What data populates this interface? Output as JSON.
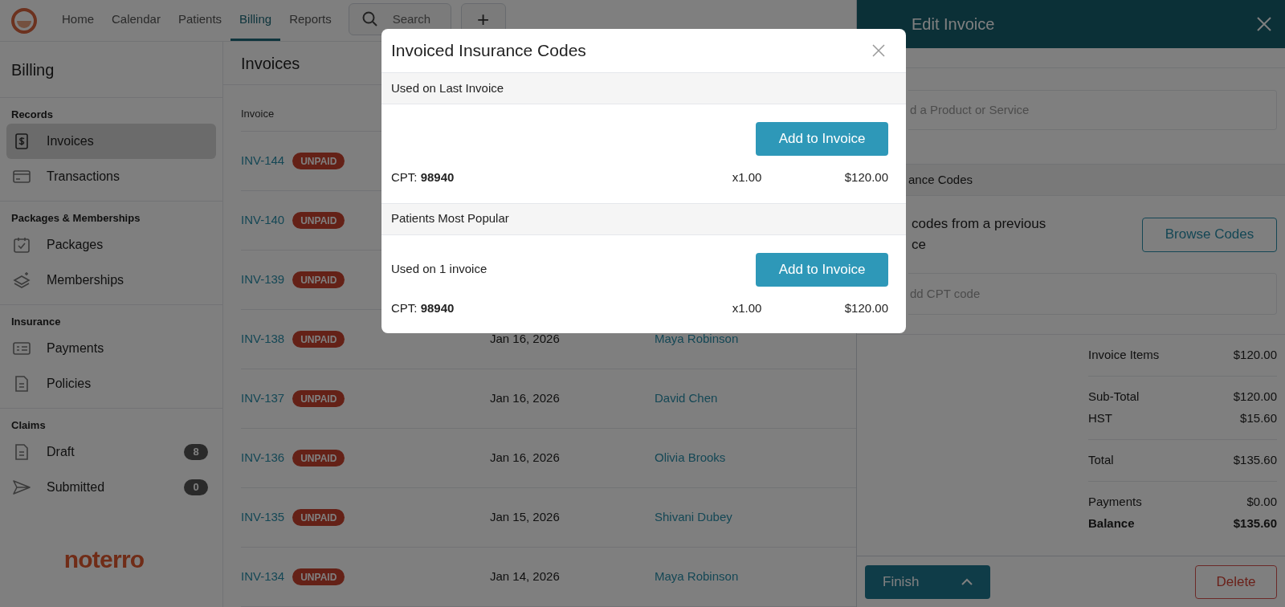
{
  "nav": {
    "items": [
      {
        "label": "Home",
        "selected": false
      },
      {
        "label": "Calendar",
        "selected": false
      },
      {
        "label": "Patients",
        "selected": false
      },
      {
        "label": "Billing",
        "selected": true
      },
      {
        "label": "Reports",
        "selected": false
      }
    ],
    "search": {
      "placeholder": "Search"
    },
    "add_button": "+"
  },
  "sidebar": {
    "title": "Billing",
    "sections": [
      {
        "heading": "Records",
        "items": [
          {
            "label": "Invoices",
            "selected": true
          },
          {
            "label": "Transactions",
            "selected": false
          }
        ]
      },
      {
        "heading": "Packages & Memberships",
        "items": [
          {
            "label": "Packages",
            "selected": false
          },
          {
            "label": "Memberships",
            "selected": false
          }
        ]
      },
      {
        "heading": "Insurance",
        "items": [
          {
            "label": "Payments",
            "selected": false
          },
          {
            "label": "Policies",
            "selected": false
          }
        ]
      },
      {
        "heading": "Claims",
        "items": [
          {
            "label": "Draft",
            "selected": false,
            "count": "8"
          },
          {
            "label": "Submitted",
            "selected": false,
            "count": "0"
          }
        ]
      }
    ],
    "brand": "noterro"
  },
  "invoices": {
    "title": "Invoices",
    "columns": [
      "Invoice"
    ],
    "rows": [
      {
        "invoice": "INV-144",
        "status": "UNPAID"
      },
      {
        "invoice": "INV-140",
        "status": "UNPAID"
      },
      {
        "invoice": "INV-139",
        "status": "UNPAID"
      },
      {
        "invoice": "INV-138",
        "status": "UNPAID",
        "date": "Jan 16, 2026",
        "patient": "Maya Robinson"
      },
      {
        "invoice": "INV-137",
        "status": "UNPAID",
        "date": "Jan 16, 2026",
        "patient": "David Chen"
      },
      {
        "invoice": "INV-136",
        "status": "UNPAID",
        "date": "Jan 16, 2026",
        "patient": "Olivia Brooks"
      },
      {
        "invoice": "INV-135",
        "status": "UNPAID",
        "date": "Jan 15, 2026",
        "patient": "Shivani Dubey"
      },
      {
        "invoice": "INV-134",
        "status": "UNPAID",
        "date": "Jan 14, 2026",
        "patient": "Maya Robinson"
      }
    ]
  },
  "edit_panel": {
    "title": "Edit Invoice",
    "product_placeholder": "d a Product or Service",
    "codes_heading": "ance Codes",
    "copy_text": [
      "codes from a previous",
      "ce"
    ],
    "browse_button": "Browse Codes",
    "cpt_placeholder": "dd CPT code",
    "totals": [
      [
        {
          "label": "Invoice Items",
          "value": "$120.00",
          "bold": false
        }
      ],
      [
        {
          "label": "Sub-Total",
          "value": "$120.00",
          "bold": false
        },
        {
          "label": "HST",
          "value": "$15.60",
          "bold": false
        }
      ],
      [
        {
          "label": "Total",
          "value": "$135.60",
          "bold": false
        }
      ],
      [
        {
          "label": "Payments",
          "value": "$0.00",
          "bold": false
        },
        {
          "label": "Balance",
          "value": "$135.60",
          "bold": true
        }
      ]
    ],
    "finish_button": "Finish",
    "delete_button": "Delete"
  },
  "modal": {
    "title": "Invoiced Insurance Codes",
    "sections": [
      {
        "heading": "Used on Last Invoice",
        "button": "Add to Invoice",
        "code": "CPT: **98940**",
        "quantity": "x1.00",
        "price": "$120.00"
      },
      {
        "heading": "Patients Most Popular",
        "note": "Used on 1 invoice",
        "button": "Add to Invoice",
        "code": "CPT: **98940**",
        "quantity": "x1.00",
        "price": "$120.00"
      }
    ]
  }
}
